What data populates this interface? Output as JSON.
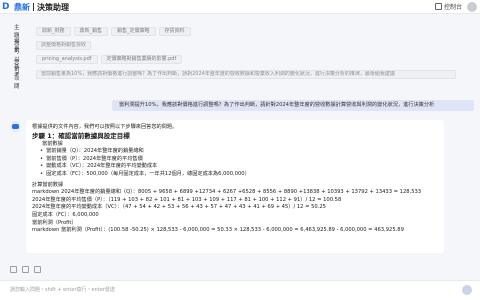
{
  "app": {
    "logo_mark": "D",
    "brand": "鼎新",
    "title": "決策助理",
    "control_label": "控制台"
  },
  "form": {
    "subject_label": "主題",
    "subject_tags": [
      "鼎新_財務",
      "鼎新_銷售",
      "銷售_定價策略",
      "存貨資料"
    ],
    "scene_label": "場景",
    "scene_tag": "調整價格對銷售營收",
    "reference_label": "您可以參考",
    "reference_tags": [
      "pricing_analysis.pdf",
      "定價策略對銷售業績的影響.pdf"
    ],
    "question_label": "您可以問",
    "question_text": "當前銷售量為10%，我應該對價格進行調整嗎？為了作出判斷，請對2024年整年度的營收數據和營業收入利潤的變化狀況，進行決策分析的推演，最後給我建議"
  },
  "chat": {
    "user_message": "當利潤提升10%，我應該對價格進行調整嗎？為了作出判斷，請針對2024年整年度的營收數據計算營收與利潤的變化狀況，進行決策分析",
    "answer": {
      "intro": "根據提供的文件內容，我們可以按照以下步驟來回答您的問題。",
      "step1": "步驟 1：確認當前數據與設定目標",
      "current_data_label": "當前數據",
      "bullets": [
        "當前銷量（Q）：2024年整年度的銷量總和",
        "當前售價（P）：2024年整年度的平均售價",
        "變動成本（VC）：2024年整年度的平均變動成本",
        "固定成本（FC）：500,000（每月固定成本，一年共12個月，總固定成本為6,000,000）"
      ],
      "calc_label": "計算當前數據",
      "calc_lines": [
        "markdown 2024年整年度的銷量總和（Q）：8005 + 9658 + 6899 +12734 + 6267 +6528 + 8556 + 8890 +13838 + 10393 + 13792 + 13433 = 128,533",
        "2024年整年度的平均售價（P）：（119 + 103 + 82 + 101 + 81 + 103 + 109 + 117 + 81 + 100 + 112 + 91）/ 12 = 100.58",
        "2024年整年度的平均變動成本（VC）：（47 + 54 + 42 + 53 + 56 + 43 + 57 + 47 + 43 + 41 + 69 + 45）/ 12 = 50.25",
        "固定成本（FC）：6,000,000"
      ],
      "profit_label": "當前利潤（Profit）",
      "profit_line": "markdown 當前利潤（Profit）：(100.58 -50.25) × 128,533 - 6,000,000 = 50.33 × 128,533 - 6,000,000 = 6,463,925.89 - 6,000,000 = 463,925.89"
    }
  },
  "composer": {
    "placeholder": "請您輸入問題・shift + enter換行・enter發送"
  },
  "icons": [
    "logo-icon",
    "console-icon",
    "user-avatar",
    "bot-avatar-icon",
    "mic-icon",
    "attach-icon",
    "expand-icon",
    "send-icon"
  ]
}
